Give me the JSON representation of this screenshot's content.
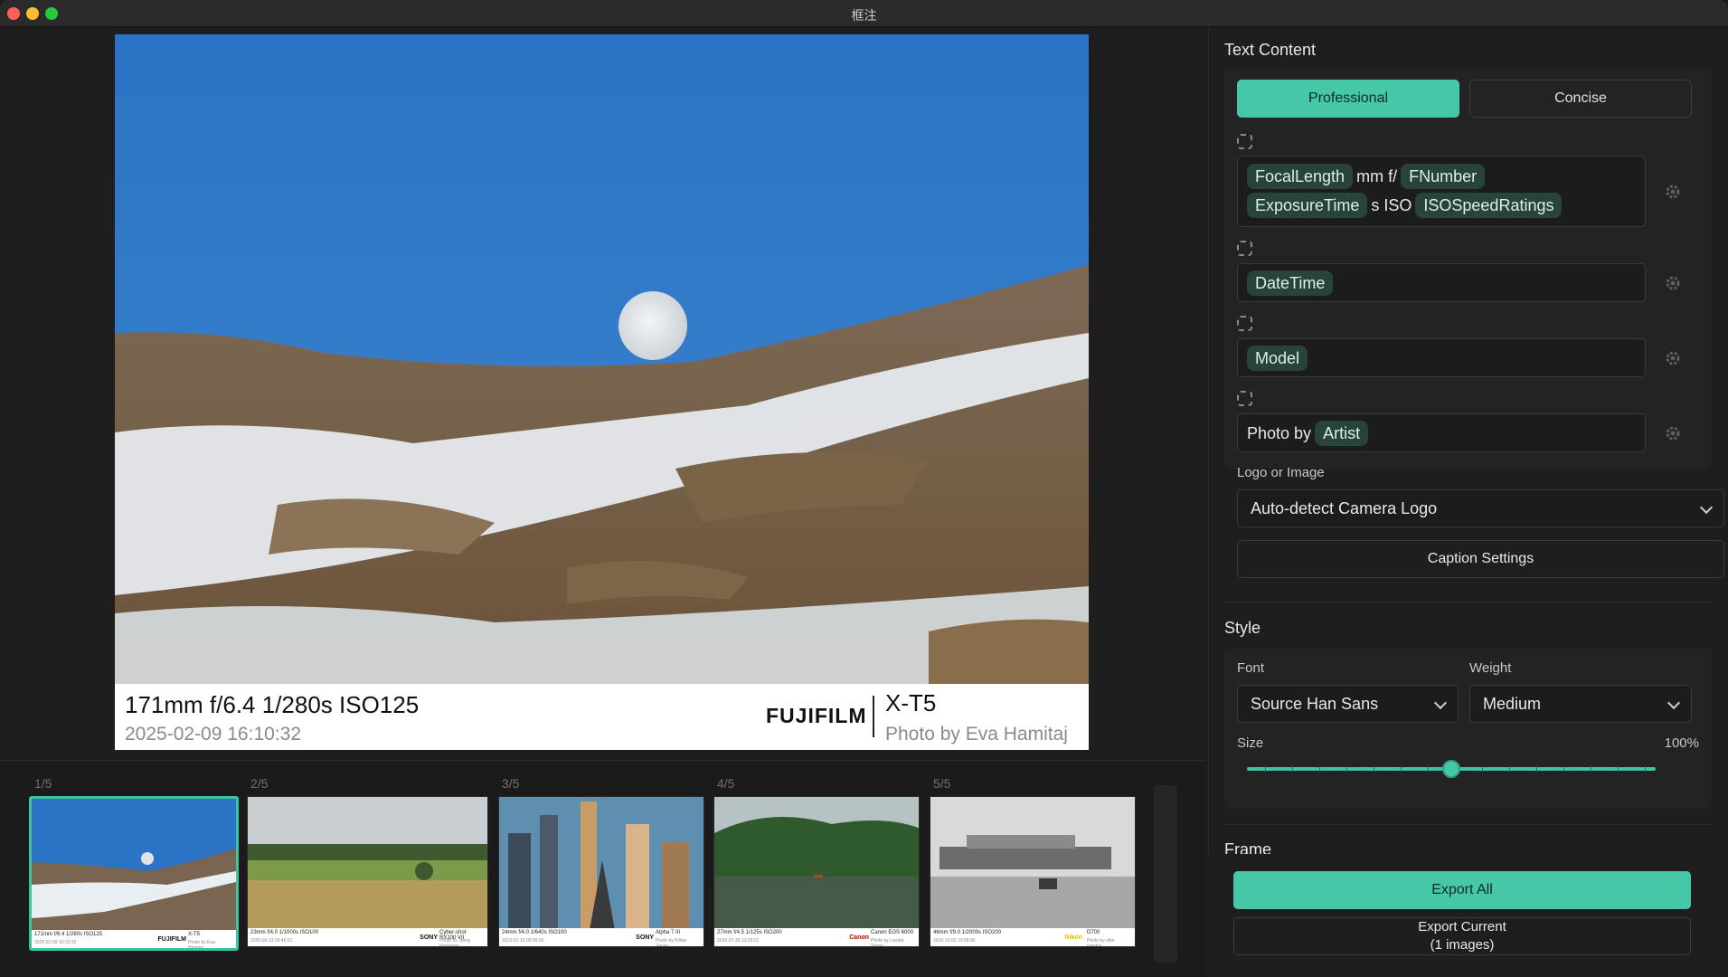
{
  "window": {
    "title": "框注"
  },
  "preview": {
    "caption_line1": "171mm f/6.4 1/280s ISO125",
    "caption_line2": "2025-02-09 16:10:32",
    "logo_text": "FUJIFILM",
    "model": "X-T5",
    "artist_line": "Photo by Eva Hamitaj"
  },
  "filmstrip": {
    "items": [
      {
        "index": "1/5",
        "line1": "171mm f/6.4 1/280s ISO125",
        "line2": "2025-02-09 16:10:32",
        "logo": "FUJIFILM",
        "model": "X-T5",
        "artist": "Photo by Eva Hamitaj"
      },
      {
        "index": "2/5",
        "line1": "23mm f/4.0 1/1000s ISO100",
        "line2": "2025-06-13 09:46:51",
        "logo": "SONY",
        "model": "Cyber-shot RX100 VII",
        "artist": "Photo by Joerg Hartmann"
      },
      {
        "index": "3/5",
        "line1": "24mm f/4.0 1/640s ISO100",
        "line2": "2019-01-10 09:36:02",
        "logo": "SONY",
        "model": "Alpha 7 III",
        "artist": "Photo by Killian Squire"
      },
      {
        "index": "4/5",
        "line1": "27mm f/4.5 1/125s ISO200",
        "line2": "2020-07-30 13:26:01",
        "logo": "Canon",
        "model": "Canon EOS 6000",
        "artist": "Photo by Leonid Simon"
      },
      {
        "index": "5/5",
        "line1": "46mm f/9.0 1/2000s ISO200",
        "line2": "2015-10-02 10:08:00",
        "logo": "Nikon",
        "model": "D700",
        "artist": "Photo by elbo nandyo"
      }
    ]
  },
  "panel": {
    "text_content_title": "Text Content",
    "mode_professional": "Professional",
    "mode_concise": "Concise",
    "row1": {
      "t1": "FocalLength",
      "p1": "mm f/",
      "t2": "FNumber",
      "t3": "ExposureTime",
      "p2": "s ISO",
      "t4": "ISOSpeedRatings"
    },
    "row2": {
      "t1": "DateTime"
    },
    "row3": {
      "t1": "Model"
    },
    "row4": {
      "p1": "Photo by",
      "t1": "Artist"
    },
    "logo_label": "Logo or Image",
    "logo_value": "Auto-detect Camera Logo",
    "caption_settings": "Caption Settings",
    "style_title": "Style",
    "font_label": "Font",
    "font_value": "Source Han Sans",
    "weight_label": "Weight",
    "weight_value": "Medium",
    "size_label": "Size",
    "size_value": "100%",
    "size_fraction": 0.5,
    "frame_title": "Frame",
    "export_all": "Export All",
    "export_current_line1": "Export Current",
    "export_current_line2": "(1 images)"
  },
  "colors": {
    "accent": "#46c8a8",
    "token_bg": "#27433b"
  }
}
